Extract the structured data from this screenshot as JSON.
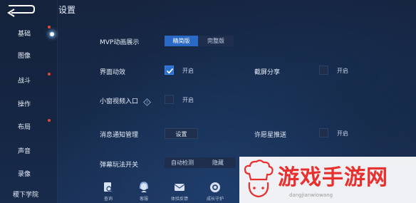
{
  "header": {
    "title": "设置"
  },
  "sidebar": {
    "items": [
      {
        "label": "基础",
        "active": true,
        "badge": true
      },
      {
        "label": "图像",
        "active": false,
        "badge": false
      },
      {
        "label": "战斗",
        "active": false,
        "badge": true
      },
      {
        "label": "操作",
        "active": false,
        "badge": false
      },
      {
        "label": "布局",
        "active": false,
        "badge": true
      },
      {
        "label": "声音",
        "active": false,
        "badge": false
      },
      {
        "label": "录像",
        "active": false,
        "badge": false
      },
      {
        "label": "稷下学院",
        "active": false,
        "badge": false
      }
    ]
  },
  "settings": {
    "mvp": {
      "label": "MVP动画展示",
      "options": [
        "精简版",
        "完整版"
      ],
      "selected": "精简版"
    },
    "ui_effect": {
      "label": "界面动效",
      "option": "开启",
      "checked": true
    },
    "screenshot_share": {
      "label": "截屏分享",
      "option": "开启",
      "checked": false
    },
    "mini_video": {
      "label": "小窗视频入口",
      "option": "开启",
      "checked": false,
      "icon": "help-icon"
    },
    "notification": {
      "label": "消息通知管理",
      "button": "设置"
    },
    "wish_star": {
      "label": "许愿星推送",
      "option": "开启",
      "checked": false
    },
    "barrage": {
      "label": "弹幕玩法开关",
      "options": [
        "自动检测",
        "隐藏"
      ]
    }
  },
  "dock": {
    "items": [
      {
        "label": "查询",
        "icon": "search-doc-icon"
      },
      {
        "label": "客服",
        "icon": "customer-service-icon"
      },
      {
        "label": "体验反馈",
        "icon": "feedback-icon"
      },
      {
        "label": "成长守护",
        "icon": "guardian-icon"
      }
    ]
  },
  "watermark": {
    "text": "游戏手游网",
    "url": "dangjianwiowang"
  },
  "colors": {
    "accent": "#2a69c4",
    "background": "#162a49",
    "badge": "#e5482f",
    "watermark_red": "#e8302f"
  }
}
